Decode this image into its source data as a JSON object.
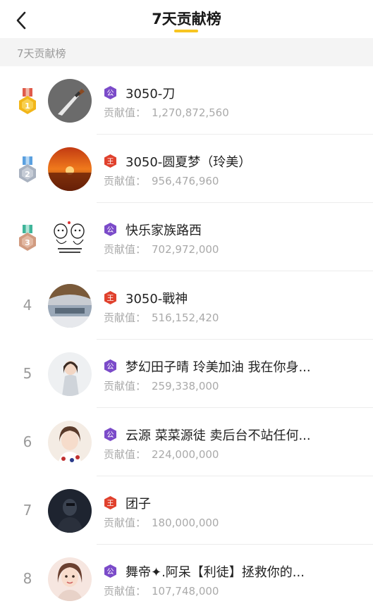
{
  "header": {
    "title": "7天贡献榜",
    "back_icon": "chevron-left-icon",
    "accent": "#f7c521"
  },
  "section": {
    "label": "7天贡献榜"
  },
  "contrib_label": "贡献值：",
  "colors": {
    "gold": "#f2b619",
    "silver": "#a9b2c0",
    "bronze": "#d19b80",
    "badge_gong": "#7b4bc9",
    "badge_wang": "#e0412d"
  },
  "rows": [
    {
      "rank": "1",
      "name": "3050-刀",
      "value": "1,270,872,560",
      "badge": "公",
      "badge_type": "gong",
      "medal": "gold"
    },
    {
      "rank": "2",
      "name": "3050-圆夏梦（玲美）",
      "value": "956,476,960",
      "badge": "王",
      "badge_type": "wang",
      "medal": "silver"
    },
    {
      "rank": "3",
      "name": "快乐家族路西",
      "value": "702,972,000",
      "badge": "公",
      "badge_type": "gong",
      "medal": "bronze"
    },
    {
      "rank": "4",
      "name": "3050-戰神",
      "value": "516,152,420",
      "badge": "王",
      "badge_type": "wang"
    },
    {
      "rank": "5",
      "name": "梦幻田子晴 玲美加油 我在你身...",
      "value": "259,338,000",
      "badge": "公",
      "badge_type": "gong"
    },
    {
      "rank": "6",
      "name": "云源 菜菜源徒 卖后台不站任何...",
      "value": "224,000,000",
      "badge": "公",
      "badge_type": "gong"
    },
    {
      "rank": "7",
      "name": "团子",
      "value": "180,000,000",
      "badge": "王",
      "badge_type": "wang"
    },
    {
      "rank": "8",
      "name": "舞帝✦.阿呆【利徒】拯救你的...",
      "value": "107,748,000",
      "badge": "公",
      "badge_type": "gong"
    }
  ]
}
